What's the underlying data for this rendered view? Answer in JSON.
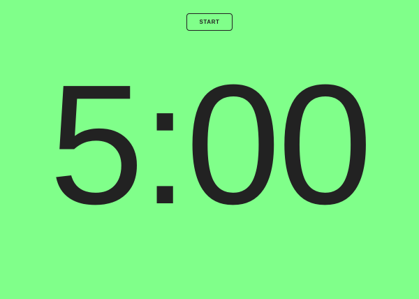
{
  "timer": {
    "start_label": "START",
    "time": "5:00"
  },
  "colors": {
    "background": "#80ff8a",
    "foreground": "#222222"
  }
}
